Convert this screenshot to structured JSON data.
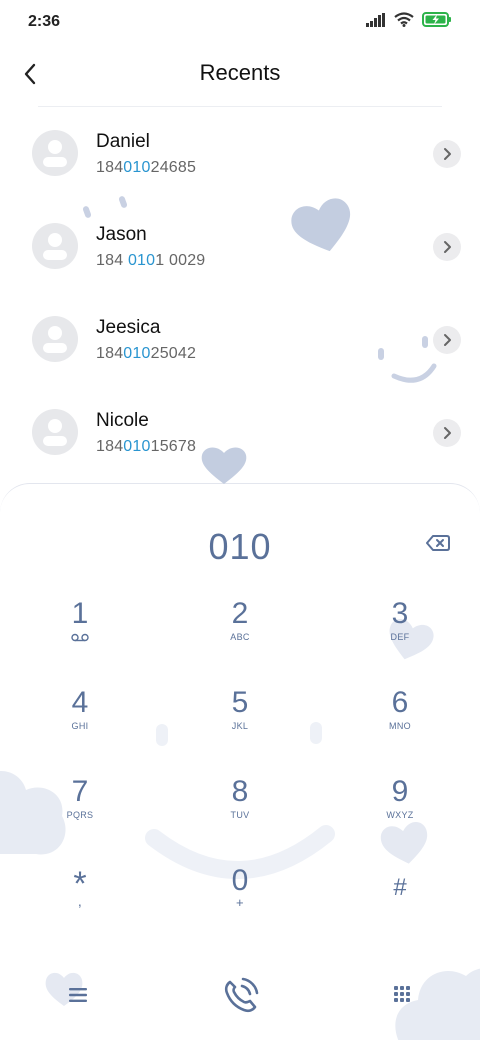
{
  "status": {
    "time": "2:36"
  },
  "header": {
    "title": "Recents"
  },
  "contacts": [
    {
      "name": "Daniel",
      "num_pre": "184",
      "num_hl": "010",
      "num_post": "24685"
    },
    {
      "name": "Jason",
      "num_pre": "184 ",
      "num_hl": "010",
      "num_post": "1 0029"
    },
    {
      "name": "Jeesica",
      "num_pre": "184",
      "num_hl": "010",
      "num_post": "25042"
    },
    {
      "name": "Nicole",
      "num_pre": "184",
      "num_hl": "010",
      "num_post": "15678"
    }
  ],
  "dialpad": {
    "display": "010",
    "keys": [
      {
        "digit": "1",
        "letters": ""
      },
      {
        "digit": "2",
        "letters": "ABC"
      },
      {
        "digit": "3",
        "letters": "DEF"
      },
      {
        "digit": "4",
        "letters": "GHI"
      },
      {
        "digit": "5",
        "letters": "JKL"
      },
      {
        "digit": "6",
        "letters": "MNO"
      },
      {
        "digit": "7",
        "letters": "PQRS"
      },
      {
        "digit": "8",
        "letters": "TUV"
      },
      {
        "digit": "9",
        "letters": "WXYZ"
      },
      {
        "digit": "*",
        "letters": ","
      },
      {
        "digit": "0",
        "letters": "+"
      },
      {
        "digit": "#",
        "letters": ""
      }
    ]
  },
  "colors": {
    "accent": "#5a7199",
    "highlight": "#2a95d0",
    "decoration": "#c9d1e3"
  }
}
